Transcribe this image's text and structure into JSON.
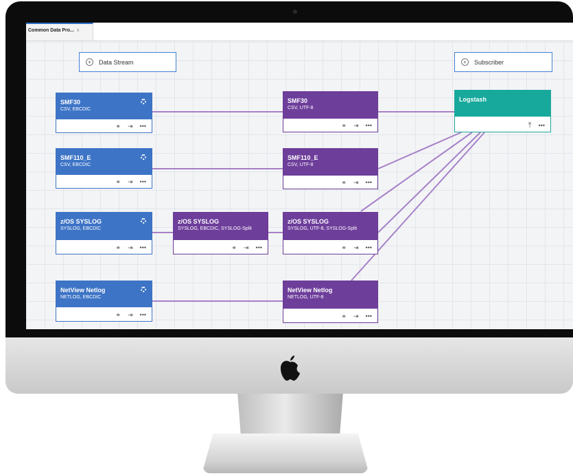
{
  "tab": {
    "label": "Common Data Pro...",
    "close": "x"
  },
  "toolbar": {
    "data_stream_label": "Data Stream",
    "subscriber_label": "Subscriber"
  },
  "sources": [
    {
      "title": "SMF30",
      "subtitle": "CSV, EBCDIC"
    },
    {
      "title": "SMF110_E",
      "subtitle": "CSV, EBCDIC"
    },
    {
      "title": "z/OS SYSLOG",
      "subtitle": "SYSLOG, EBCDIC"
    },
    {
      "title": "NetView Netlog",
      "subtitle": "NETLOG, EBCDIC"
    }
  ],
  "transforms": [
    {
      "title": "SMF30",
      "subtitle": "CSV, UTF-8"
    },
    {
      "title": "SMF110_E",
      "subtitle": "CSV, UTF-8"
    },
    {
      "title": "z/OS SYSLOG",
      "subtitle": "SYSLOG, EBCDIC, SYSLOG-Split"
    },
    {
      "title": "z/OS SYSLOG",
      "subtitle": "SYSLOG, UTF-8, SYSLOG-Split"
    },
    {
      "title": "NetView Netlog",
      "subtitle": "NETLOG, UTF-8"
    }
  ],
  "subscriber": {
    "title": "Logstash"
  },
  "icons": {
    "flow": "flow-icon",
    "export": "export-icon",
    "more": "overflow-menu-icon",
    "upload": "upload-icon",
    "gear": "settings-icon"
  },
  "glyphs": {
    "more": "•••",
    "plus": "+",
    "upload": "⤒"
  },
  "colors": {
    "source": "#3d74c6",
    "transform": "#6e3e9b",
    "subscriber": "#17a99c",
    "link": "#a680c8"
  }
}
